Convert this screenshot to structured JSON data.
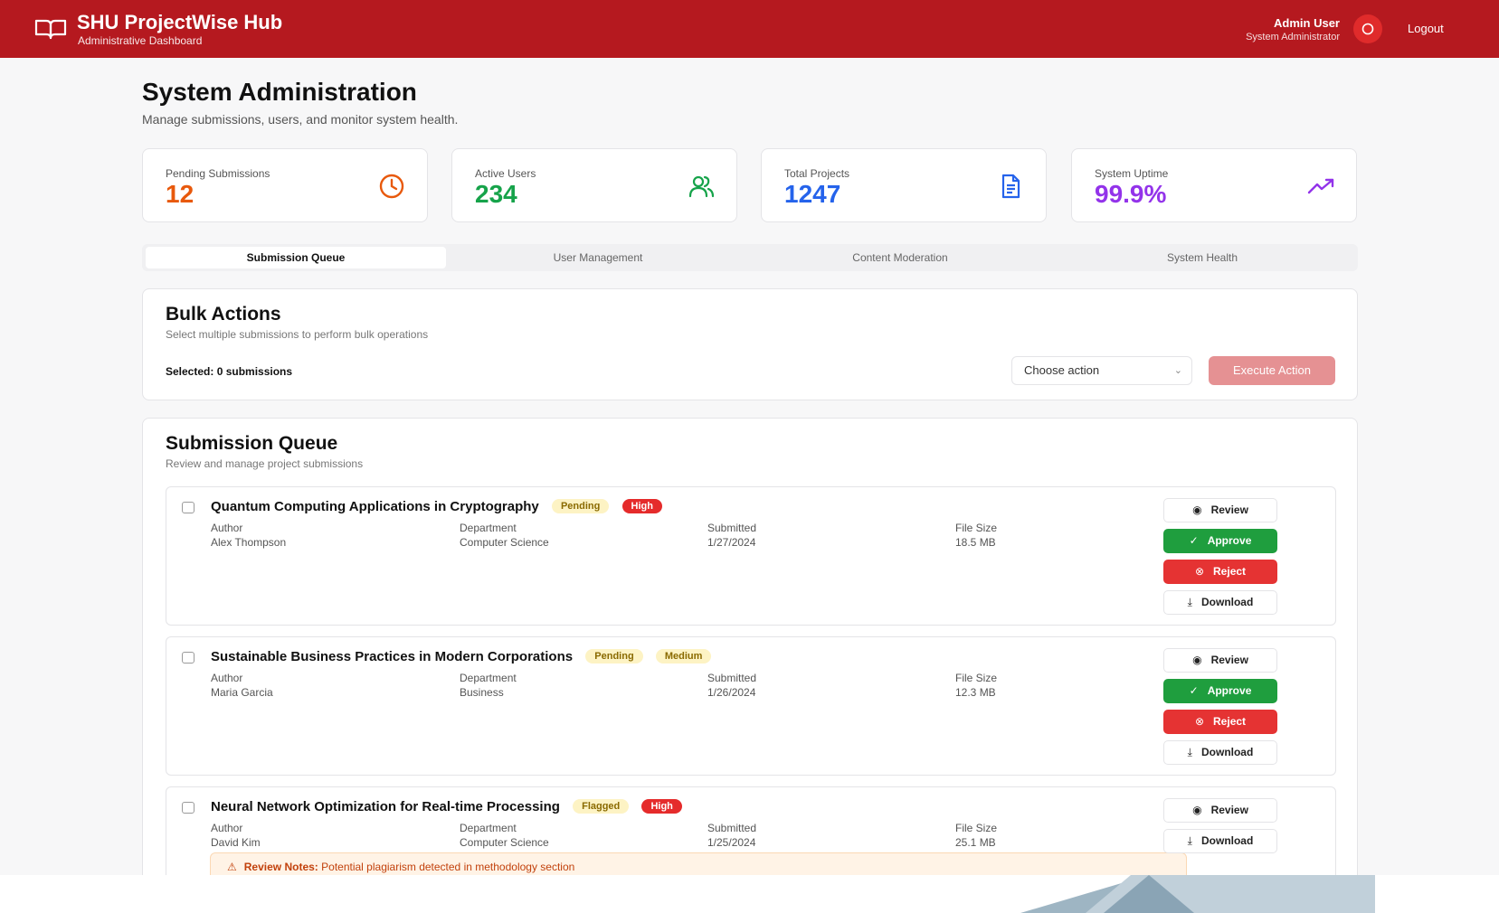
{
  "header": {
    "title": "SHU ProjectWise Hub",
    "subtitle": "Administrative Dashboard",
    "user_name": "Admin User",
    "user_role": "System Administrator",
    "logout_label": "Logout",
    "brand_color": "#b5191f"
  },
  "page": {
    "title": "System Administration",
    "subtitle": "Manage submissions, users, and monitor system health."
  },
  "stats": [
    {
      "label": "Pending Submissions",
      "value": "12",
      "color": "#e8590c",
      "icon": "clock-icon"
    },
    {
      "label": "Active Users",
      "value": "234",
      "color": "#16a34a",
      "icon": "users-icon"
    },
    {
      "label": "Total Projects",
      "value": "1247",
      "color": "#2563eb",
      "icon": "document-icon"
    },
    {
      "label": "System Uptime",
      "value": "99.9%",
      "color": "#9333ea",
      "icon": "trending-up-icon"
    }
  ],
  "tabs": [
    "Submission Queue",
    "User Management",
    "Content Moderation",
    "System Health"
  ],
  "bulk": {
    "title": "Bulk Actions",
    "subtitle": "Select multiple submissions to perform bulk operations",
    "selected_text": "Selected: 0 submissions",
    "select_value": "Choose action",
    "execute_label": "Execute Action"
  },
  "queue": {
    "title": "Submission Queue",
    "subtitle": "Review and manage project submissions",
    "meta_labels": {
      "author": "Author",
      "department": "Department",
      "submitted": "Submitted",
      "file_size": "File Size"
    },
    "actions": {
      "review": "Review",
      "approve": "Approve",
      "reject": "Reject",
      "download": "Download"
    },
    "items": [
      {
        "title": "Quantum Computing Applications in Cryptography",
        "status": "Pending",
        "priority": "High",
        "author": "Alex Thompson",
        "department": "Computer Science",
        "submitted": "1/27/2024",
        "file_size": "18.5 MB"
      },
      {
        "title": "Sustainable Business Practices in Modern Corporations",
        "status": "Pending",
        "priority": "Medium",
        "author": "Maria Garcia",
        "department": "Business",
        "submitted": "1/26/2024",
        "file_size": "12.3 MB"
      },
      {
        "title": "Neural Network Optimization for Real-time Processing",
        "status": "Flagged",
        "priority": "High",
        "author": "David Kim",
        "department": "Computer Science",
        "submitted": "1/25/2024",
        "file_size": "25.1 MB",
        "notes_label": "Review Notes:",
        "notes_text": "Potential plagiarism detected in methodology section"
      }
    ]
  }
}
